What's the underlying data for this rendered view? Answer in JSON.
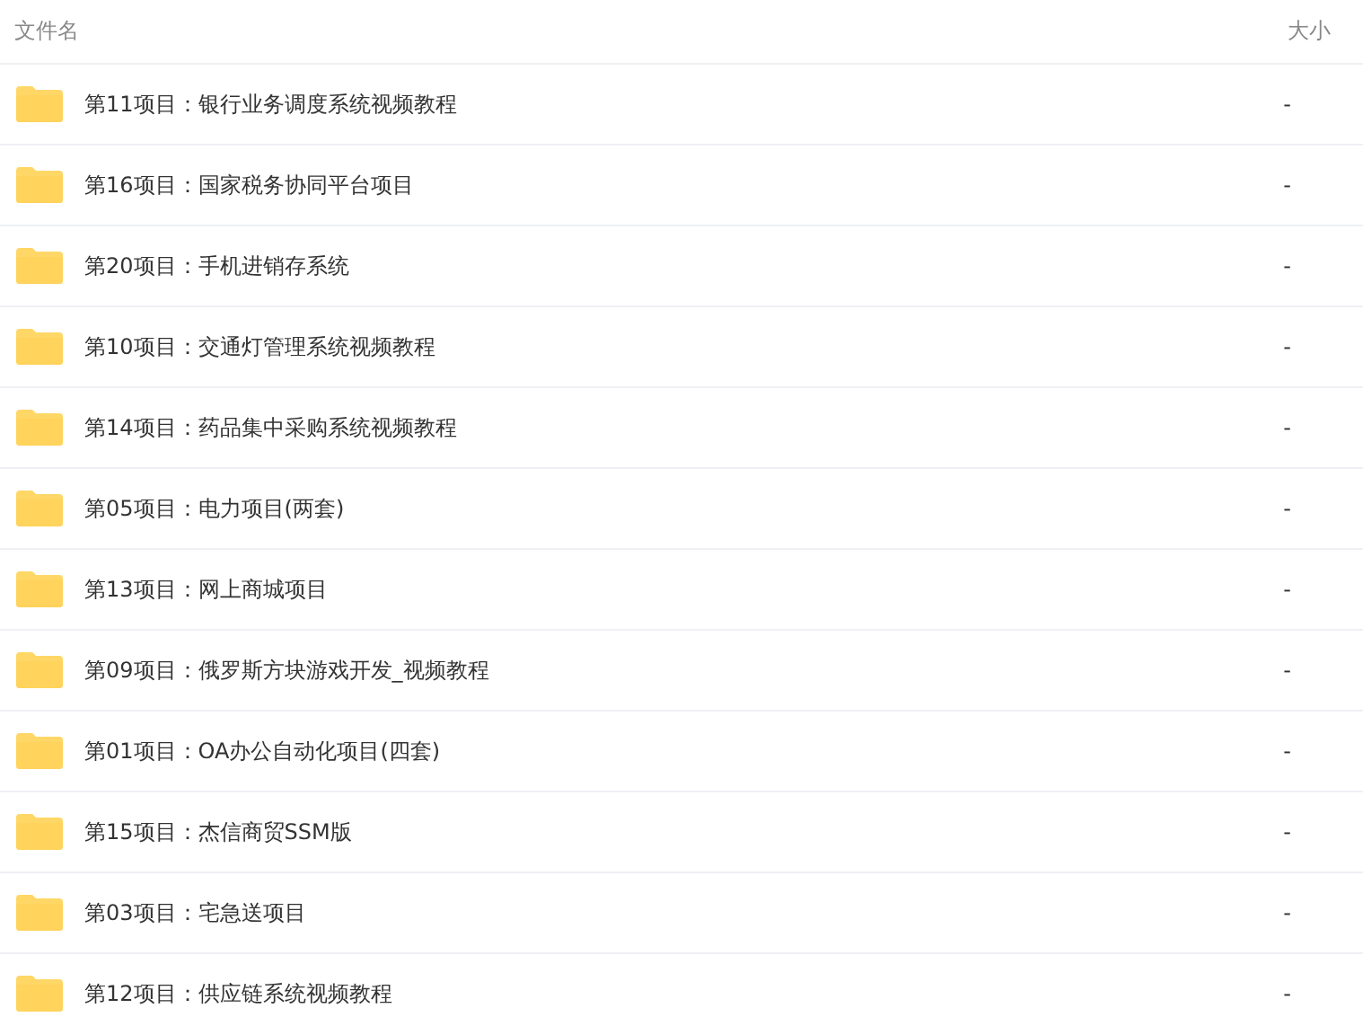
{
  "columns": [
    "文件名",
    "大小"
  ],
  "rows": [
    {
      "name": "第11项目：银行业务调度系统视频教程",
      "size": "-"
    },
    {
      "name": "第16项目：国家税务协同平台项目",
      "size": "-"
    },
    {
      "name": "第20项目：手机进销存系统",
      "size": "-"
    },
    {
      "name": "第10项目：交通灯管理系统视频教程",
      "size": "-"
    },
    {
      "name": "第14项目：药品集中采购系统视频教程",
      "size": "-"
    },
    {
      "name": "第05项目：电力项目(两套)",
      "size": "-"
    },
    {
      "name": "第13项目：网上商城项目",
      "size": "-"
    },
    {
      "name": "第09项目：俄罗斯方块游戏开发_视频教程",
      "size": "-"
    },
    {
      "name": "第01项目：OA办公自动化项目(四套)",
      "size": "-"
    },
    {
      "name": "第15项目：杰信商贸SSM版",
      "size": "-"
    },
    {
      "name": "第03项目：宅急送项目",
      "size": "-"
    },
    {
      "name": "第12项目：供应链系统视频教程",
      "size": "-"
    }
  ]
}
